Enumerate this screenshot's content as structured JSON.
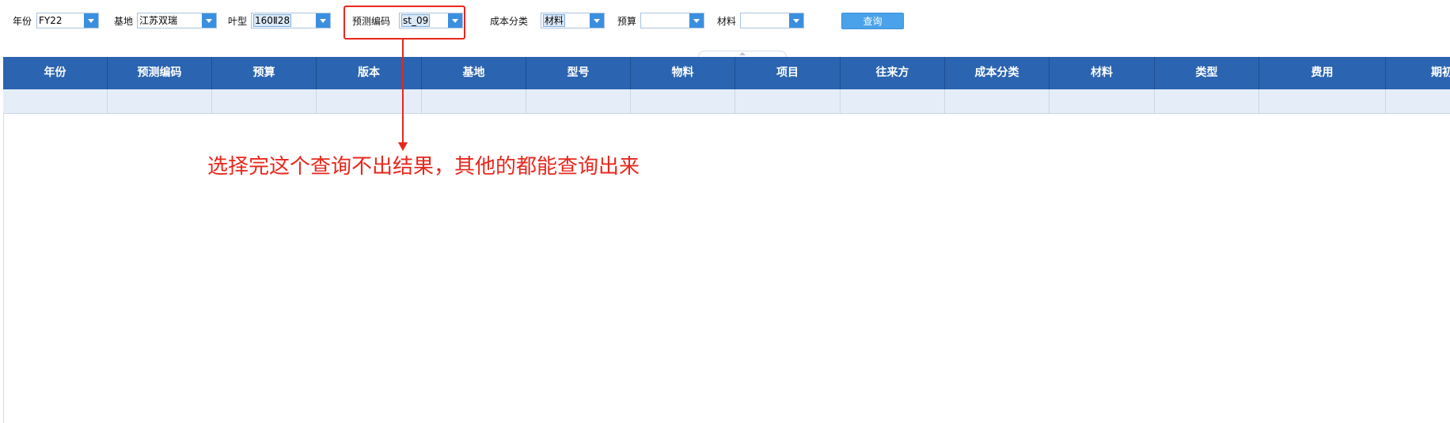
{
  "filters": {
    "year": {
      "label": "年份",
      "value": "FY22"
    },
    "base": {
      "label": "基地",
      "value": "江苏双瑞"
    },
    "blade_type": {
      "label": "叶型",
      "value": "160Ⅱ28"
    },
    "forecast_code": {
      "label": "预测编码",
      "value": "st_09"
    },
    "cost_category": {
      "label": "成本分类",
      "value": "材料"
    },
    "budget": {
      "label": "预算",
      "value": ""
    },
    "material": {
      "label": "材料",
      "value": ""
    },
    "query_button": "查询"
  },
  "grid": {
    "columns": [
      "年份",
      "预测编码",
      "预算",
      "版本",
      "基地",
      "型号",
      "物料",
      "项目",
      "往来方",
      "成本分类",
      "材料",
      "类型",
      "费用",
      "期初"
    ]
  },
  "annotation": {
    "text": "选择完这个查询不出结果，其他的都能查询出来",
    "color": "#e8271c"
  },
  "colors": {
    "header_bg": "#2b64b0",
    "row_bg": "#e5eef8",
    "button_bg": "#4aa3ea",
    "dropdown_arrow": "#3b8fe0"
  }
}
